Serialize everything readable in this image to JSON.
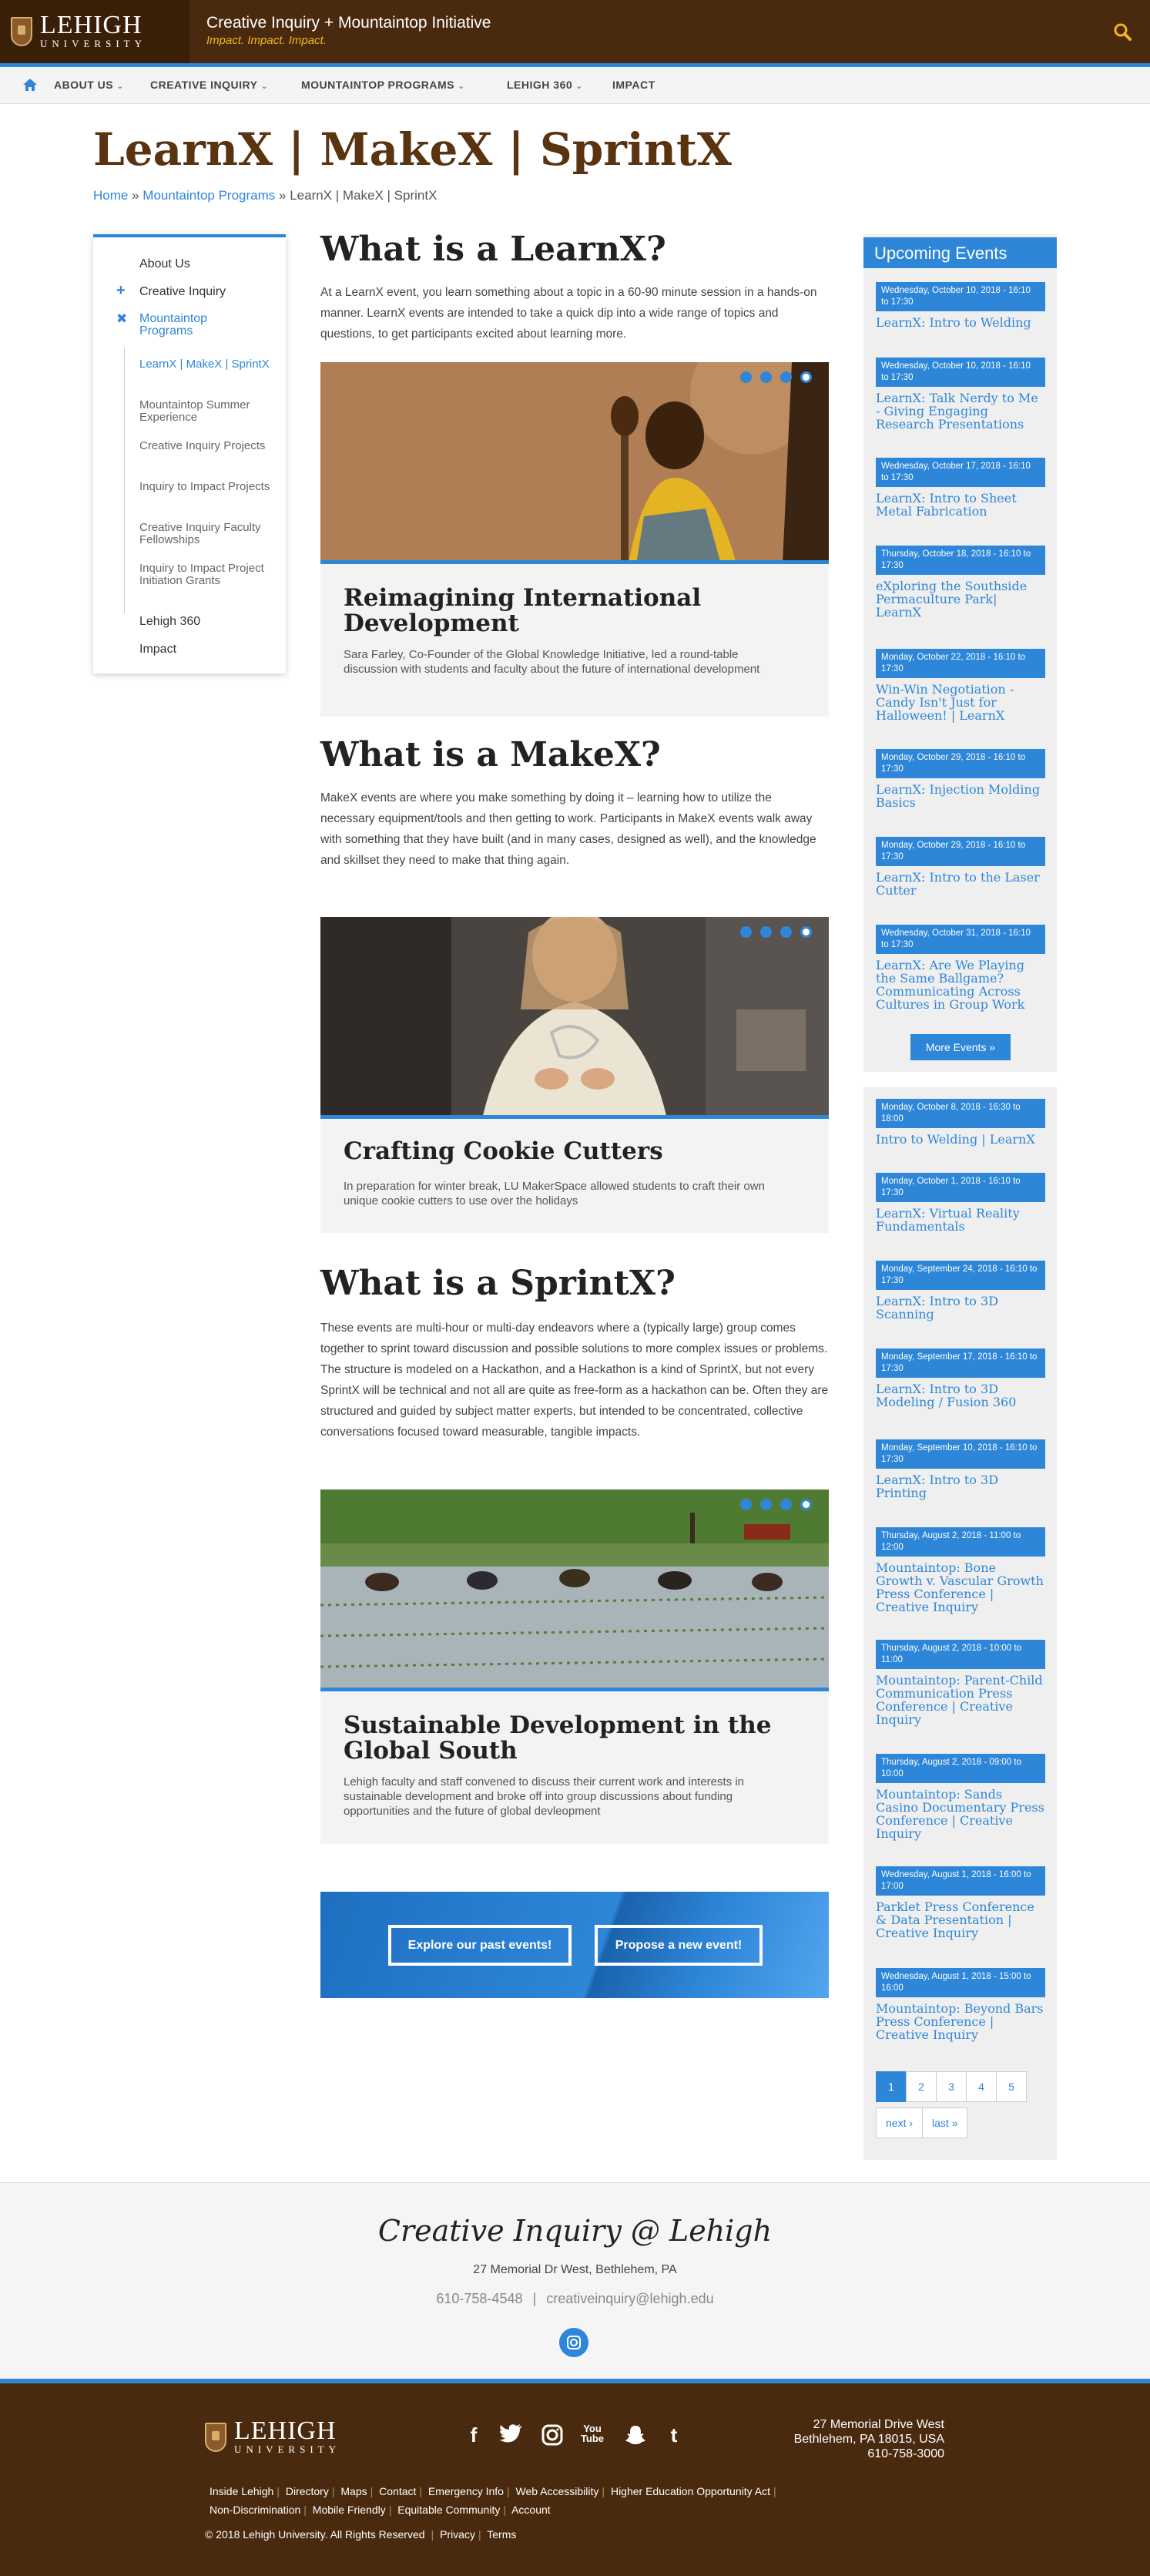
{
  "header": {
    "logo_main": "LEHIGH",
    "logo_sub": "UNIVERSITY",
    "site_title": "Creative Inquiry + Mountaintop Initiative",
    "site_subtitle": "Impact. Impact. Impact."
  },
  "nav": {
    "items": [
      "ABOUT US",
      "CREATIVE INQUIRY",
      "MOUNTAINTOP PROGRAMS",
      "LEHIGH 360",
      "IMPACT"
    ]
  },
  "page": {
    "title": "LearnX | MakeX | SprintX",
    "breadcrumb_home": "Home",
    "breadcrumb_sep": "»",
    "breadcrumb_programs": "Mountaintop Programs",
    "breadcrumb_current": "LearnX | MakeX | SprintX"
  },
  "sidebar": {
    "about": "About Us",
    "creative_inquiry": "Creative Inquiry",
    "mountaintop": "Mountaintop Programs",
    "subs": [
      "LearnX | MakeX | SprintX",
      "Mountaintop Summer Experience",
      "Creative Inquiry Projects",
      "Inquiry to Impact Projects",
      "Creative Inquiry Faculty Fellowships",
      "Inquiry to Impact Project Initiation Grants"
    ],
    "lehigh360": "Lehigh 360",
    "impact": "Impact"
  },
  "sections": {
    "learnx_heading": "What is a LearnX?",
    "learnx_text": "At a LearnX event, you learn something about a topic in a 60-90 minute session in a hands-on manner. LearnX events are intended to take a quick dip into a wide range of topics and questions, to get participants excited about learning more.",
    "learnx_card_title": "Reimagining International Development",
    "learnx_card_desc": "Sara Farley, Co-Founder of the Global Knowledge Initiative, led a round-table discussion with students and faculty about the future of international development",
    "makex_heading": "What is a MakeX?",
    "makex_text": "MakeX events are where you make something by doing it – learning how to utilize the necessary equipment/tools and then getting to work. Participants in MakeX events walk away with something that they have built (and in many cases, designed as well), and the knowledge and skillset they need to make that thing again.",
    "makex_card_title": "Crafting Cookie Cutters",
    "makex_card_desc": "In preparation for winter break, LU MakerSpace allowed students to craft their own unique cookie cutters to use over the holidays",
    "sprintx_heading": "What is a SprintX?",
    "sprintx_text": "These events are multi-hour or multi-day endeavors where a (typically large) group comes together to sprint toward discussion and possible solutions to more complex issues or problems. The structure is modeled on a Hackathon, and a Hackathon is a kind of SprintX, but not every SprintX will be technical and not all are quite as free-form as a hackathon can be. Often they are structured and guided by subject matter experts, but intended to be concentrated, collective conversations focused toward measurable, tangible impacts.",
    "sprintx_card_title": "Sustainable Development in the Global South",
    "sprintx_card_desc": "Lehigh faculty and staff convened to discuss their current work and interests in sustainable development and broke off into group discussions about funding opportunities and the future of global devleopment"
  },
  "cta": {
    "past": "Explore our past events!",
    "propose": "Propose a new event!"
  },
  "events": {
    "heading": "Upcoming Events",
    "upcoming": [
      {
        "date": "Wednesday, October 10, 2018 - 16:10 to 17:30",
        "title": "LearnX: Intro to Welding"
      },
      {
        "date": "Wednesday, October 10, 2018 - 16:10 to 17:30",
        "title": "LearnX: Talk Nerdy to Me - Giving Engaging Research Presentations"
      },
      {
        "date": "Wednesday, October 17, 2018 - 16:10 to 17:30",
        "title": "LearnX: Intro to Sheet Metal Fabrication"
      },
      {
        "date": "Thursday, October 18, 2018 - 16:10 to 17:30",
        "title": "eXploring the Southside Permaculture Park| LearnX"
      },
      {
        "date": "Monday, October 22, 2018 - 16:10 to 17:30",
        "title": "Win-Win Negotiation - Candy Isn't Just for Halloween! | LearnX"
      },
      {
        "date": "Monday, October 29, 2018 - 16:10 to 17:30",
        "title": "LearnX: Injection Molding Basics"
      },
      {
        "date": "Monday, October 29, 2018 - 16:10 to 17:30",
        "title": "LearnX: Intro to the Laser Cutter"
      },
      {
        "date": "Wednesday, October 31, 2018 - 16:10 to 17:30",
        "title": "LearnX: Are We Playing the Same Ballgame? Communicating Across Cultures in Group Work"
      }
    ],
    "more_label": "More Events »",
    "past": [
      {
        "date": "Monday, October 8, 2018 - 16:30 to 18:00",
        "title": "Intro to Welding | LearnX"
      },
      {
        "date": "Monday, October 1, 2018 - 16:10 to 17:30",
        "title": "LearnX: Virtual Reality Fundamentals"
      },
      {
        "date": "Monday, September 24, 2018 - 16:10 to 17:30",
        "title": "LearnX: Intro to 3D Scanning"
      },
      {
        "date": "Monday, September 17, 2018 - 16:10 to 17:30",
        "title": "LearnX: Intro to 3D Modeling / Fusion 360"
      },
      {
        "date": "Monday, September 10, 2018 - 16:10 to 17:30",
        "title": "LearnX: Intro to 3D Printing"
      },
      {
        "date": "Thursday, August 2, 2018 - 11:00 to 12:00",
        "title": "Mountaintop: Bone Growth v. Vascular Growth Press Conference | Creative Inquiry"
      },
      {
        "date": "Thursday, August 2, 2018 - 10:00 to 11:00",
        "title": "Mountaintop: Parent-Child Communication Press Conference | Creative Inquiry"
      },
      {
        "date": "Thursday, August 2, 2018 - 09:00 to 10:00",
        "title": "Mountaintop: Sands Casino Documentary Press Conference | Creative Inquiry"
      },
      {
        "date": "Wednesday, August 1, 2018 - 16:00 to 17:00",
        "title": "Parklet Press Conference & Data Presentation | Creative Inquiry"
      },
      {
        "date": "Wednesday, August 1, 2018 - 15:00 to 16:00",
        "title": "Mountaintop: Beyond Bars Press Conference | Creative Inquiry"
      }
    ],
    "pages": [
      "1",
      "2",
      "3",
      "4",
      "5"
    ],
    "next_label": "next ›",
    "last_label": "last »"
  },
  "footer": {
    "heading": "Creative Inquiry @ Lehigh",
    "address": "27 Memorial Dr West, Bethlehem, PA",
    "phone": "610-758-4548",
    "contact_sep": "|",
    "email": "creativeinquiry@lehigh.edu",
    "addr_line1": "27 Memorial Drive West",
    "addr_line2": "Bethlehem, PA 18015, USA",
    "addr_line3": "610-758-3000",
    "links_row1": [
      "Inside Lehigh",
      "Directory",
      "Maps",
      "Contact",
      "Emergency Info",
      "Web Accessibility",
      "Higher Education Opportunity Act"
    ],
    "links_row2": [
      "Non-Discrimination",
      "Mobile Friendly",
      "Equitable Community",
      "Account"
    ],
    "copyright": "© 2018 Lehigh University.  All Rights Reserved",
    "privacy": "Privacy",
    "terms": "Terms",
    "social_icons": [
      "facebook-icon",
      "twitter-icon",
      "instagram-icon",
      "youtube-icon",
      "snapchat-icon",
      "tumblr-icon"
    ],
    "youtube_text": "You Tube"
  },
  "colors": {
    "brown": "#4a2a0e",
    "blue": "#2e86d8",
    "gold": "#f2b51d"
  }
}
